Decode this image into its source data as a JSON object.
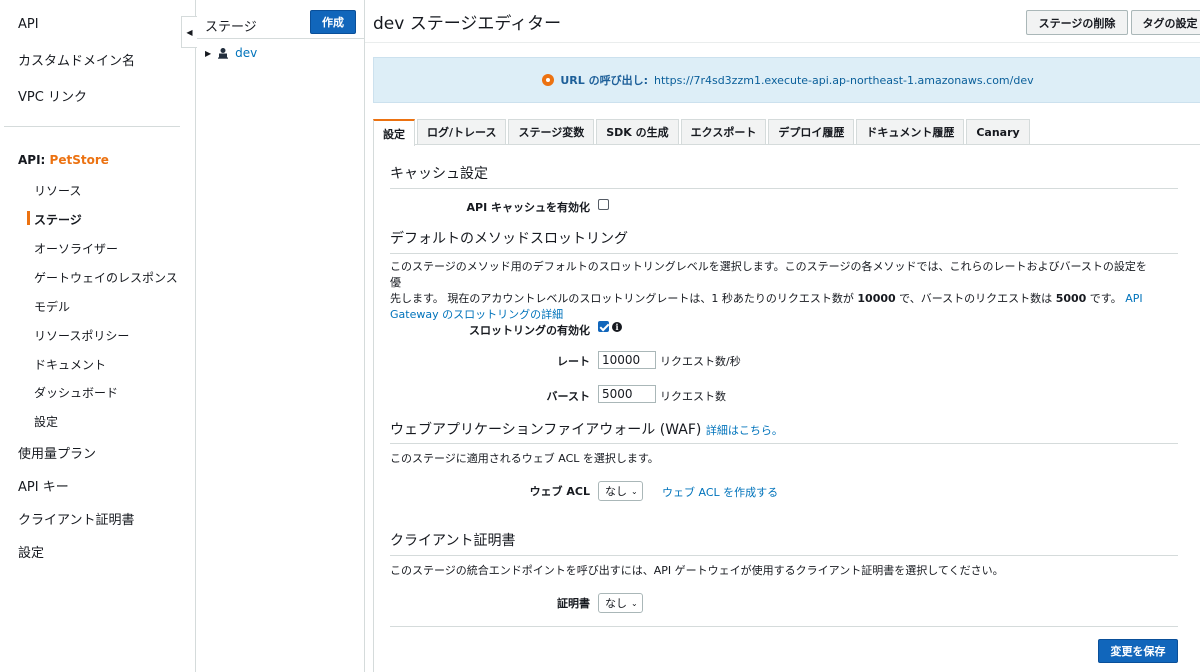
{
  "leftnav": {
    "top_items": [
      "API",
      "カスタムドメイン名",
      "VPC リンク"
    ],
    "api_prefix": "API: ",
    "api_name": "PetStore",
    "sub_items": [
      "リソース",
      "ステージ",
      "オーソライザー",
      "ゲートウェイのレスポンス",
      "モデル",
      "リソースポリシー",
      "ドキュメント",
      "ダッシュボード",
      "設定"
    ],
    "active_sub": "ステージ",
    "bottom_items": [
      "使用量プラン",
      "API キー",
      "クライアント証明書",
      "設定"
    ]
  },
  "stage_panel": {
    "title": "ステージ",
    "create_label": "作成",
    "tree_item": "dev"
  },
  "header": {
    "title": "dev ステージエディター",
    "delete_label": "ステージの削除",
    "tags_label": "タグの設定"
  },
  "url_banner": {
    "label": "URL の呼び出し:",
    "url": "https://7r4sd3zzm1.execute-api.ap-northeast-1.amazonaws.com/dev"
  },
  "tabs": [
    "設定",
    "ログ/トレース",
    "ステージ変数",
    "SDK の生成",
    "エクスポート",
    "デプロイ履歴",
    "ドキュメント履歴",
    "Canary"
  ],
  "active_tab": "設定",
  "cache": {
    "title": "キャッシュ設定",
    "enable_label": "API キャッシュを有効化",
    "enabled": false
  },
  "throttling": {
    "title": "デフォルトのメソッドスロットリング",
    "desc_1": "このステージのメソッド用のデフォルトのスロットリングレベルを選択します。このステージの各メソッドでは、これらのレートおよびバーストの設定を優",
    "desc_2a": "先します。 現在のアカウントレベルのスロットリングレートは、1 秒あたりのリクエスト数が ",
    "desc_rate": "10000",
    "desc_2b": " で、バーストのリクエスト数は ",
    "desc_burst": "5000",
    "desc_2c": " です。 ",
    "desc_link_1": "API",
    "desc_link_2": "Gateway のスロットリングの詳細",
    "enable_label": "スロットリングの有効化",
    "enabled": true,
    "rate_label": "レート",
    "rate_value": "10000",
    "rate_unit": "リクエスト数/秒",
    "burst_label": "バースト",
    "burst_value": "5000",
    "burst_unit": "リクエスト数"
  },
  "waf": {
    "title": "ウェブアプリケーションファイアウォール (WAF)",
    "details_link": "詳細はこちら。",
    "desc": "このステージに適用されるウェブ ACL を選択します。",
    "acl_label": "ウェブ ACL",
    "acl_value": "なし",
    "create_link": "ウェブ ACL を作成する"
  },
  "client_cert": {
    "title": "クライアント証明書",
    "desc": "このステージの統合エンドポイントを呼び出すには、API ゲートウェイが使用するクライアント証明書を選択してください。",
    "cert_label": "証明書",
    "cert_value": "なし"
  },
  "save_label": "変更を保存",
  "colors": {
    "accent": "#ec7211",
    "primary_button": "#1166bb",
    "link": "#0073bb",
    "banner_bg": "#ddeef7"
  }
}
